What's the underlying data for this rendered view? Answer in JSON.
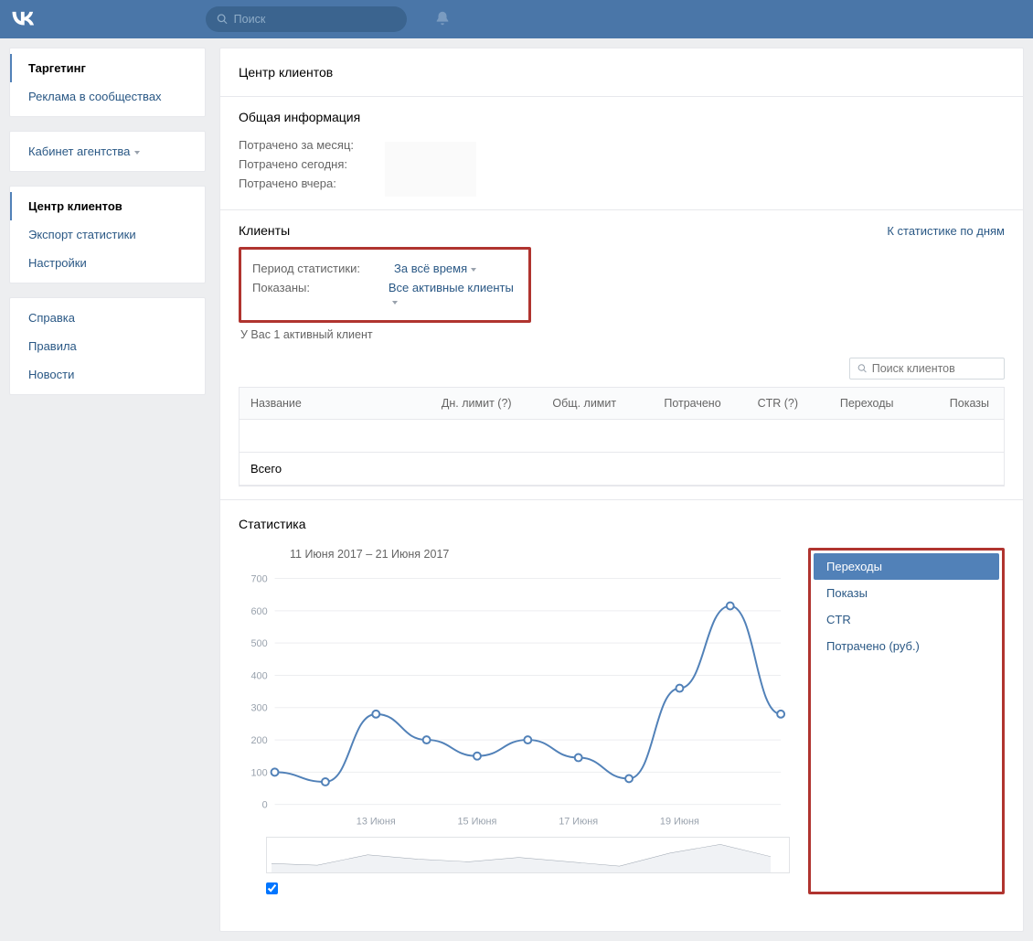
{
  "topbar": {
    "search_placeholder": "Поиск"
  },
  "sidebar": {
    "block1": [
      {
        "label": "Таргетинг",
        "active": true
      },
      {
        "label": "Реклама в сообществах",
        "active": false
      }
    ],
    "block2": [
      {
        "label": "Кабинет агентства",
        "has_caret": true
      }
    ],
    "block3": [
      {
        "label": "Центр клиентов",
        "active": true
      },
      {
        "label": "Экспорт статистики"
      },
      {
        "label": "Настройки"
      }
    ],
    "block4": [
      {
        "label": "Справка"
      },
      {
        "label": "Правила"
      },
      {
        "label": "Новости"
      }
    ]
  },
  "main_title": "Центр клиентов",
  "general": {
    "title": "Общая информация",
    "rows": [
      "Потрачено за месяц:",
      "Потрачено сегодня:",
      "Потрачено вчера:"
    ]
  },
  "clients": {
    "title": "Клиенты",
    "link": "К статистике по дням",
    "filter": {
      "period_label": "Период статистики:",
      "period_value": "За всё время",
      "shown_label": "Показаны:",
      "shown_value": "Все активные клиенты"
    },
    "hint": "У Вас 1 активный клиент",
    "search_placeholder": "Поиск клиентов",
    "columns": [
      "Название",
      "Дн. лимит (?)",
      "Общ. лимит",
      "Потрачено",
      "CTR (?)",
      "Переходы",
      "Показы"
    ],
    "total_label": "Всего"
  },
  "stats": {
    "title": "Статистика",
    "date_range": "11 Июня 2017 – 21 Июня 2017",
    "metrics": [
      "Переходы",
      "Показы",
      "CTR",
      "Потрачено (руб.)"
    ],
    "active_metric": 0
  },
  "chart_data": {
    "type": "line",
    "title": "",
    "xlabel": "",
    "ylabel": "",
    "ylim": [
      0,
      700
    ],
    "y_ticks": [
      0,
      100,
      200,
      300,
      400,
      500,
      600,
      700
    ],
    "x_labels": [
      "13 Июня",
      "15 Июня",
      "17 Июня",
      "19 Июня"
    ],
    "x": [
      "11 Июня",
      "12 Июня",
      "13 Июня",
      "14 Июня",
      "15 Июня",
      "16 Июня",
      "17 Июня",
      "18 Июня",
      "19 Июня",
      "20 Июня",
      "21 Июня"
    ],
    "values": [
      100,
      70,
      280,
      200,
      150,
      200,
      145,
      80,
      360,
      615,
      280
    ]
  }
}
